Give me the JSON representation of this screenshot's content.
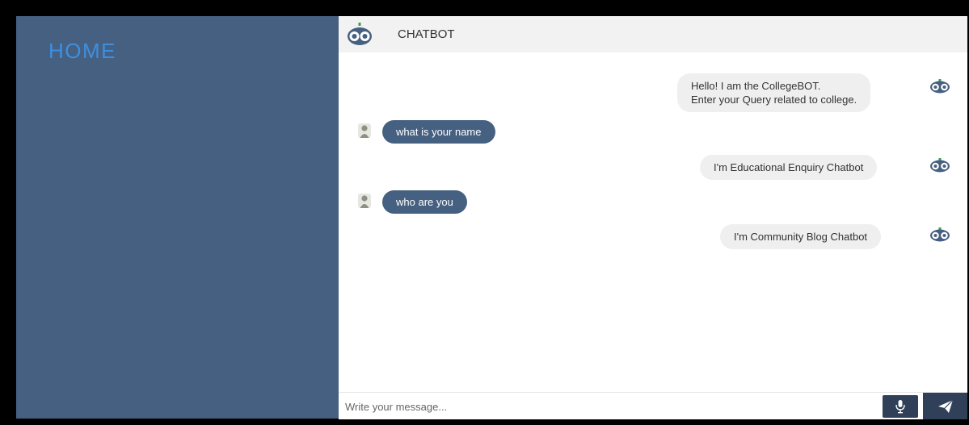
{
  "sidebar": {
    "title": "HOME"
  },
  "header": {
    "title": "CHATBOT",
    "logo_icon": "robot-face-icon"
  },
  "messages": [
    {
      "from": "bot",
      "lines": [
        "Hello! I am the CollegeBOT.",
        "Enter your Query related to college."
      ]
    },
    {
      "from": "user",
      "text": "what is your name"
    },
    {
      "from": "bot",
      "text": "I'm Educational Enquiry Chatbot"
    },
    {
      "from": "user",
      "text": "who are you"
    },
    {
      "from": "bot",
      "text": "I'm Community Blog Chatbot"
    }
  ],
  "composer": {
    "placeholder": "Write your message...",
    "mic_icon": "microphone-icon",
    "send_icon": "paper-plane-icon"
  },
  "colors": {
    "sidebar_bg": "#456080",
    "home_title": "#3f8fe0",
    "user_bubble": "#456080",
    "bot_bubble": "#efefef",
    "button_bg": "#2f4058"
  }
}
